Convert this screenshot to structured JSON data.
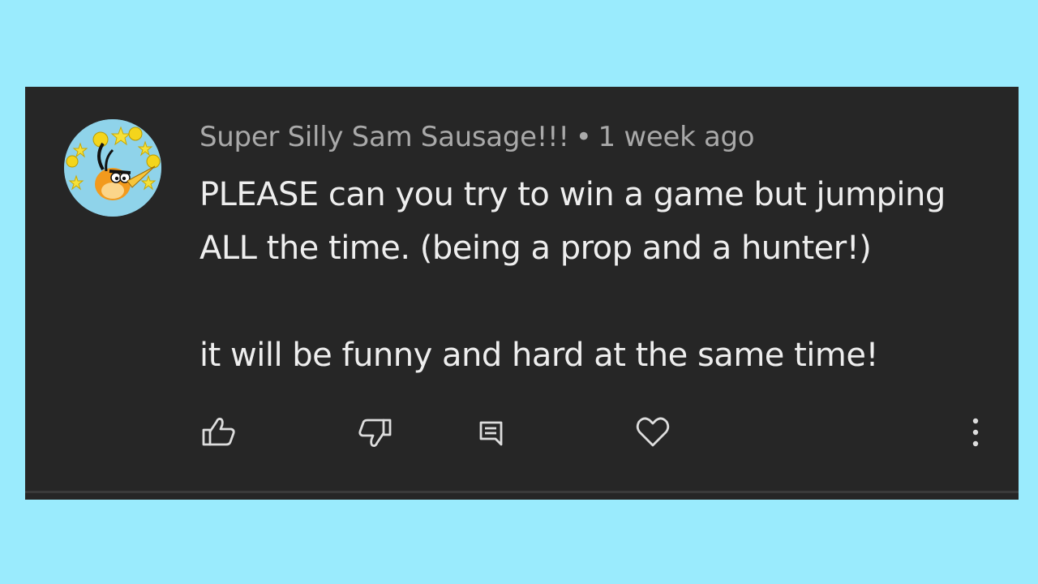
{
  "comment": {
    "author": "Super Silly Sam Sausage!!!",
    "separator": "•",
    "timestamp": "1 week ago",
    "lines": [
      "PLEASE can you try to win a game but jumping",
      "ALL the time. (being a prop and a hunter!)",
      "",
      "it will be funny and hard at the same time!"
    ]
  },
  "actions": {
    "like_icon": "thumbs-up-icon",
    "dislike_icon": "thumbs-down-icon",
    "reply_icon": "reply-comment-icon",
    "heart_icon": "heart-icon",
    "more_icon": "more-vertical-icon"
  },
  "colors": {
    "background": "#9aebfd",
    "card": "#262626",
    "meta_text": "#a9a9a9",
    "body_text": "#eeeeee",
    "icon": "#dddddd"
  }
}
